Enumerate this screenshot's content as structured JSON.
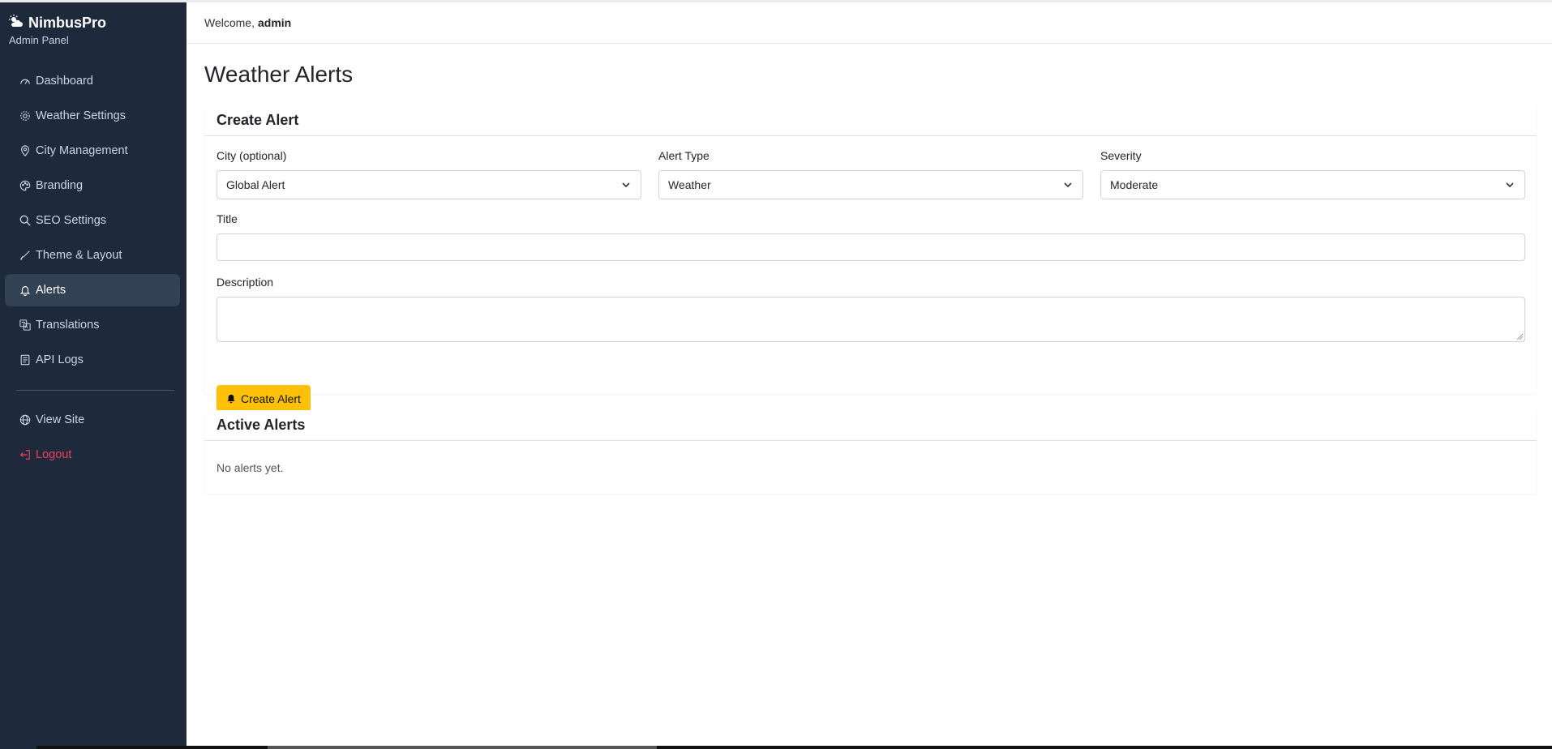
{
  "brand": {
    "title": "NimbusPro",
    "subtitle": "Admin Panel"
  },
  "sidebar": {
    "items": [
      {
        "label": "Dashboard",
        "icon": "speedometer-icon"
      },
      {
        "label": "Weather Settings",
        "icon": "gear-icon"
      },
      {
        "label": "City Management",
        "icon": "location-pin-icon"
      },
      {
        "label": "Branding",
        "icon": "palette-icon"
      },
      {
        "label": "SEO Settings",
        "icon": "search-icon"
      },
      {
        "label": "Theme & Layout",
        "icon": "brush-icon"
      },
      {
        "label": "Alerts",
        "icon": "bell-icon",
        "active": true
      },
      {
        "label": "Translations",
        "icon": "translate-icon"
      },
      {
        "label": "API Logs",
        "icon": "document-icon"
      }
    ],
    "secondary": [
      {
        "label": "View Site",
        "icon": "globe-icon"
      },
      {
        "label": "Logout",
        "icon": "logout-icon"
      }
    ]
  },
  "header": {
    "welcome": "Welcome,",
    "user": "admin"
  },
  "page": {
    "title": "Weather Alerts"
  },
  "create_card": {
    "title": "Create Alert",
    "city_label": "City (optional)",
    "city_value": "Global Alert",
    "type_label": "Alert Type",
    "type_value": "Weather",
    "severity_label": "Severity",
    "severity_value": "Moderate",
    "title_label": "Title",
    "title_value": "",
    "description_label": "Description",
    "description_value": "",
    "button_label": "Create Alert"
  },
  "active_card": {
    "title": "Active Alerts",
    "empty_text": "No alerts yet."
  },
  "colors": {
    "sidebar_bg": "#1e293b",
    "accent": "#ffc107",
    "logout": "#f43f5e",
    "active_bg": "#334155"
  }
}
